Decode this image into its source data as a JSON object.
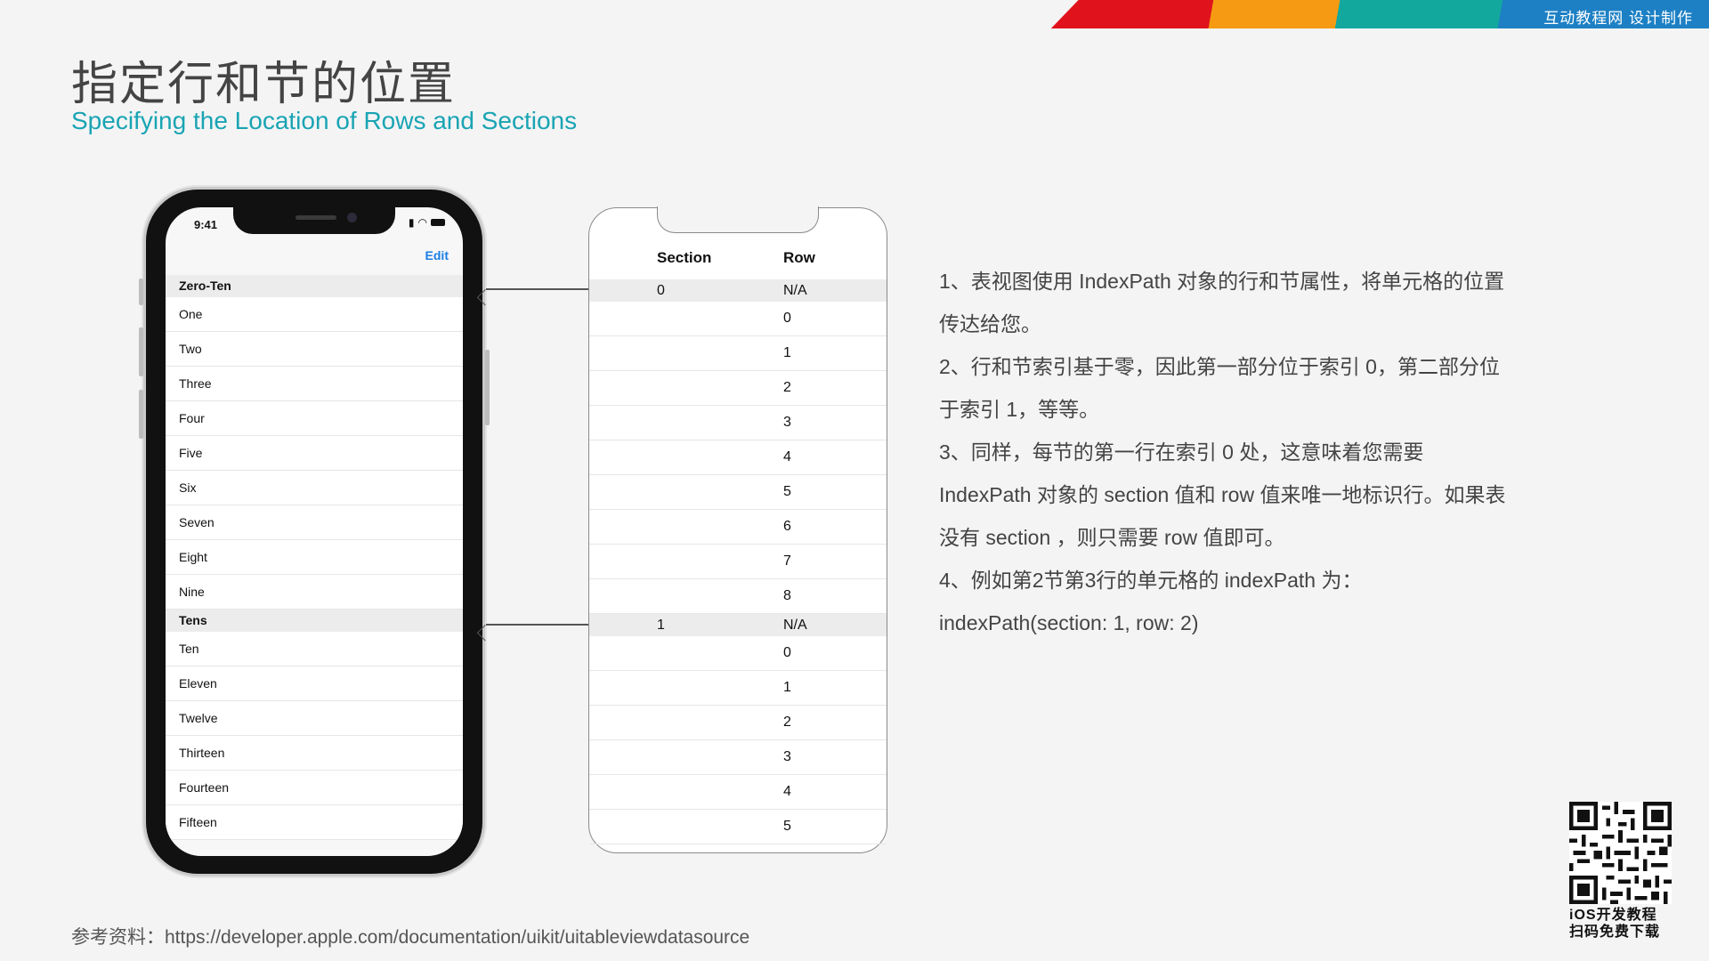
{
  "banner": {
    "text": "互动教程网 设计制作"
  },
  "title": {
    "zh": "指定行和节的位置",
    "en": "Specifying the Location of Rows and Sections"
  },
  "phone": {
    "time": "9:41",
    "edit": "Edit",
    "sections": [
      {
        "header": "Zero-Ten",
        "rows": [
          "One",
          "Two",
          "Three",
          "Four",
          "Five",
          "Six",
          "Seven",
          "Eight",
          "Nine"
        ]
      },
      {
        "header": "Tens",
        "rows": [
          "Ten",
          "Eleven",
          "Twelve",
          "Thirteen",
          "Fourteen",
          "Fifteen"
        ]
      }
    ]
  },
  "table": {
    "section_header": "Section",
    "row_header": "Row",
    "rows": [
      {
        "section": "0",
        "row": "N/A",
        "type": "head"
      },
      {
        "section": "",
        "row": "0",
        "type": "body"
      },
      {
        "section": "",
        "row": "1",
        "type": "body"
      },
      {
        "section": "",
        "row": "2",
        "type": "body"
      },
      {
        "section": "",
        "row": "3",
        "type": "body"
      },
      {
        "section": "",
        "row": "4",
        "type": "body"
      },
      {
        "section": "",
        "row": "5",
        "type": "body"
      },
      {
        "section": "",
        "row": "6",
        "type": "body"
      },
      {
        "section": "",
        "row": "7",
        "type": "body"
      },
      {
        "section": "",
        "row": "8",
        "type": "body"
      },
      {
        "section": "1",
        "row": "N/A",
        "type": "head"
      },
      {
        "section": "",
        "row": "0",
        "type": "body"
      },
      {
        "section": "",
        "row": "1",
        "type": "body"
      },
      {
        "section": "",
        "row": "2",
        "type": "body"
      },
      {
        "section": "",
        "row": "3",
        "type": "body"
      },
      {
        "section": "",
        "row": "4",
        "type": "body"
      },
      {
        "section": "",
        "row": "5",
        "type": "body"
      }
    ]
  },
  "description": [
    "1、表视图使用 IndexPath 对象的行和节属性，将单元格的位置",
    "传达给您。",
    "2、行和节索引基于零，因此第一部分位于索引 0，第二部分位",
    "于索引 1，等等。",
    "3、同样，每节的第一行在索引 0 处，这意味着您需要",
    "IndexPath 对象的 section 值和 row 值来唯一地标识行。如果表",
    "没有 section ，则只需要 row 值即可。",
    "4、例如第2节第3行的单元格的 indexPath 为：",
    "indexPath(section: 1, row: 2)"
  ],
  "reference": "参考资料：https://developer.apple.com/documentation/uikit/uitableviewdatasource",
  "qr": {
    "caption_line1": "iOS开发教程",
    "caption_line2": "扫码免费下载"
  }
}
